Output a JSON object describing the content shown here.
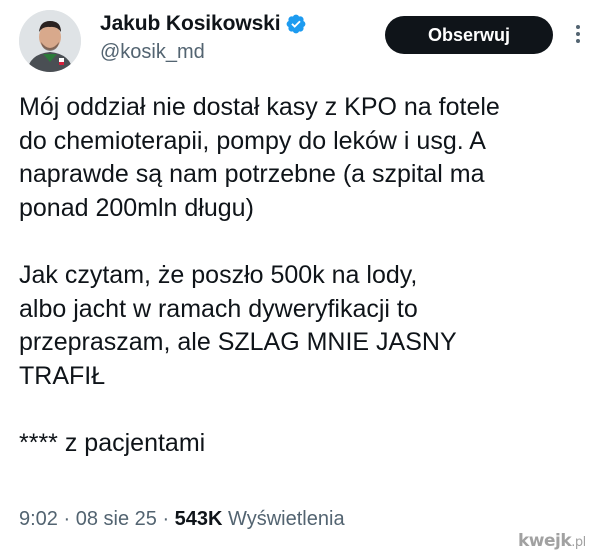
{
  "author": {
    "name": "Jakub Kosikowski",
    "handle": "@kosik_md",
    "verified_icon": "verified-badge-icon"
  },
  "actions": {
    "follow_label": "Obserwuj",
    "more_icon": "more-vertical-icon"
  },
  "tweet": {
    "paragraph1": [
      "Mój oddział nie dostał kasy z KPO na fotele",
      "do chemioterapii, pompy do leków i usg. A",
      "naprawde są nam potrzebne (a szpital ma",
      "ponad 200mln długu)"
    ],
    "paragraph2": [
      "Jak czytam, że poszło 500k na lody,",
      "albo jacht w ramach dyweryfikacji to",
      "przepraszam, ale SZLAG MNIE JASNY",
      "TRAFIŁ"
    ],
    "paragraph3": [
      "**** z pacjentami"
    ]
  },
  "meta": {
    "time": "9:02",
    "separator": " · ",
    "date": "08 sie 25",
    "views_count": "543K",
    "views_label": " Wyświetlenia"
  },
  "watermark": {
    "brand": "kwejk",
    "suffix": ".pl"
  },
  "colors": {
    "text_primary": "#0f1419",
    "text_secondary": "#536471",
    "button_bg": "#0f1419",
    "verified_blue": "#1d9bf0"
  }
}
